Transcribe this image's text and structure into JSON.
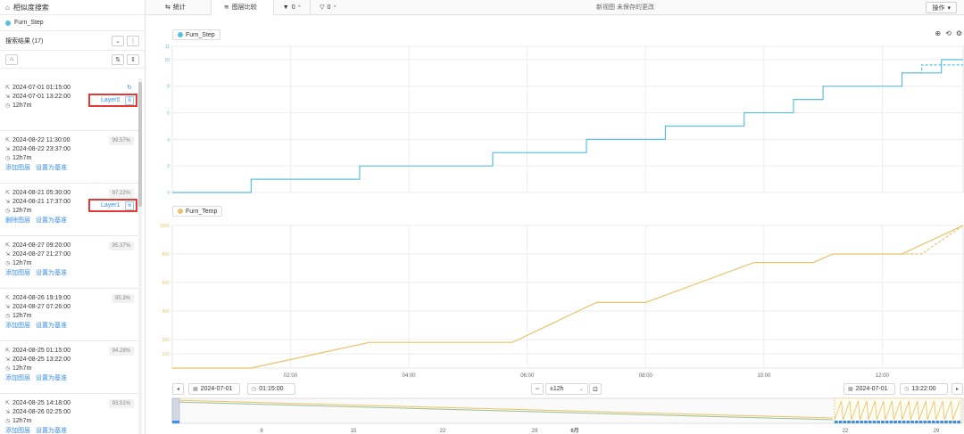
{
  "sidebar": {
    "title": "相似度搜索",
    "tag": "Furn_Step",
    "results_label": "搜索结果 (17)",
    "results": [
      {
        "start": "2024-07-01 01:15:00",
        "end": "2024-07-01 13:22:00",
        "duration": "12h7m",
        "pct": "",
        "layer": "Layer0",
        "layer_icon": "8",
        "actions": []
      },
      {
        "start": "2024-08-22 11:30:00",
        "end": "2024-08-22 23:37:00",
        "duration": "12h7m",
        "pct": "99.57%",
        "layer": "",
        "actions": [
          "添加图层",
          "设置为基准"
        ]
      },
      {
        "start": "2024-08-21 05:30:00",
        "end": "2024-08-21 17:37:00",
        "duration": "12h7m",
        "pct": "97.22%",
        "layer": "Layer1",
        "layer_icon": "≋",
        "actions": [
          "删除图层",
          "设置为基准"
        ]
      },
      {
        "start": "2024-08-27 09:20:00",
        "end": "2024-08-27 21:27:00",
        "duration": "12h7m",
        "pct": "95.37%",
        "layer": "",
        "actions": [
          "添加图层",
          "设置为基准"
        ]
      },
      {
        "start": "2024-08-26 19:19:00",
        "end": "2024-08-27 07:26:00",
        "duration": "12h7m",
        "pct": "95.3%",
        "layer": "",
        "actions": [
          "添加图层",
          "设置为基准"
        ]
      },
      {
        "start": "2024-08-25 01:15:00",
        "end": "2024-08-25 13:22:00",
        "duration": "12h7m",
        "pct": "94.28%",
        "layer": "",
        "actions": [
          "添加图层",
          "设置为基准"
        ]
      },
      {
        "start": "2024-08-25 14:18:00",
        "end": "2024-08-26 02:25:00",
        "duration": "12h7m",
        "pct": "93.51%",
        "layer": "",
        "actions": [
          "添加图层",
          "设置为基准"
        ]
      }
    ]
  },
  "header": {
    "tabs": [
      {
        "label": "统计"
      },
      {
        "label": "图层比较"
      },
      {
        "label": "0"
      },
      {
        "label": "0"
      }
    ],
    "status": "新视图 未保存的更改",
    "ops_label": "操作"
  },
  "colors": {
    "step": "#5bc0de",
    "temp": "#e8c46a",
    "accent": "#3a8ee6",
    "highlight": "#e53935"
  },
  "chart_data": [
    {
      "type": "line",
      "name": "Furn_Step",
      "ylim": [
        0,
        11
      ],
      "y_ticks": [
        "11",
        "10",
        "8",
        "6",
        "4",
        "2",
        "0"
      ],
      "series": [
        {
          "name": "Furn_Step",
          "style": "solid",
          "x": [
            "00:00",
            "01:20",
            "01:20",
            "03:10",
            "03:10",
            "05:25",
            "05:25",
            "07:00",
            "07:00",
            "08:20",
            "08:20",
            "09:40",
            "09:40",
            "10:30",
            "10:30",
            "11:00",
            "11:00",
            "12:20",
            "12:20",
            "13:00",
            "13:00",
            "13:22"
          ],
          "y": [
            0,
            0,
            1,
            1,
            2,
            2,
            3,
            3,
            4,
            4,
            5,
            5,
            6,
            6,
            7,
            7,
            8,
            8,
            9,
            9,
            10,
            10
          ]
        },
        {
          "name": "Layer1",
          "style": "dashed",
          "x": [
            "12:20",
            "12:40",
            "12:40",
            "13:22"
          ],
          "y": [
            9,
            9,
            9.6,
            9.6
          ]
        }
      ]
    },
    {
      "type": "line",
      "name": "Furn_Temp",
      "ylim": [
        0,
        1000
      ],
      "y_ticks": [
        "1000",
        "800",
        "600",
        "400",
        "200",
        "100"
      ],
      "series": [
        {
          "name": "Furn_Temp",
          "style": "solid",
          "x": [
            "00:00",
            "01:20",
            "03:20",
            "05:45",
            "07:10",
            "08:00",
            "09:50",
            "10:50",
            "11:10",
            "12:20",
            "13:22"
          ],
          "y": [
            0,
            0,
            180,
            180,
            460,
            460,
            740,
            740,
            800,
            800,
            1000
          ]
        },
        {
          "name": "Layer1",
          "style": "dashed",
          "x": [
            "12:20",
            "12:40",
            "13:22"
          ],
          "y": [
            800,
            800,
            1000
          ]
        }
      ]
    }
  ],
  "x_ticks": [
    "02:00",
    "04:00",
    "06:00",
    "08:00",
    "10:00",
    "12:00"
  ],
  "time_controls": {
    "start_date": "2024-07-01",
    "start_time": "01:15:00",
    "step": "±12h",
    "end_date": "2024-07-01",
    "end_time": "13:22:00"
  },
  "overview_ticks": [
    "8",
    "15",
    "22",
    "29",
    "8月",
    "22",
    "29"
  ]
}
